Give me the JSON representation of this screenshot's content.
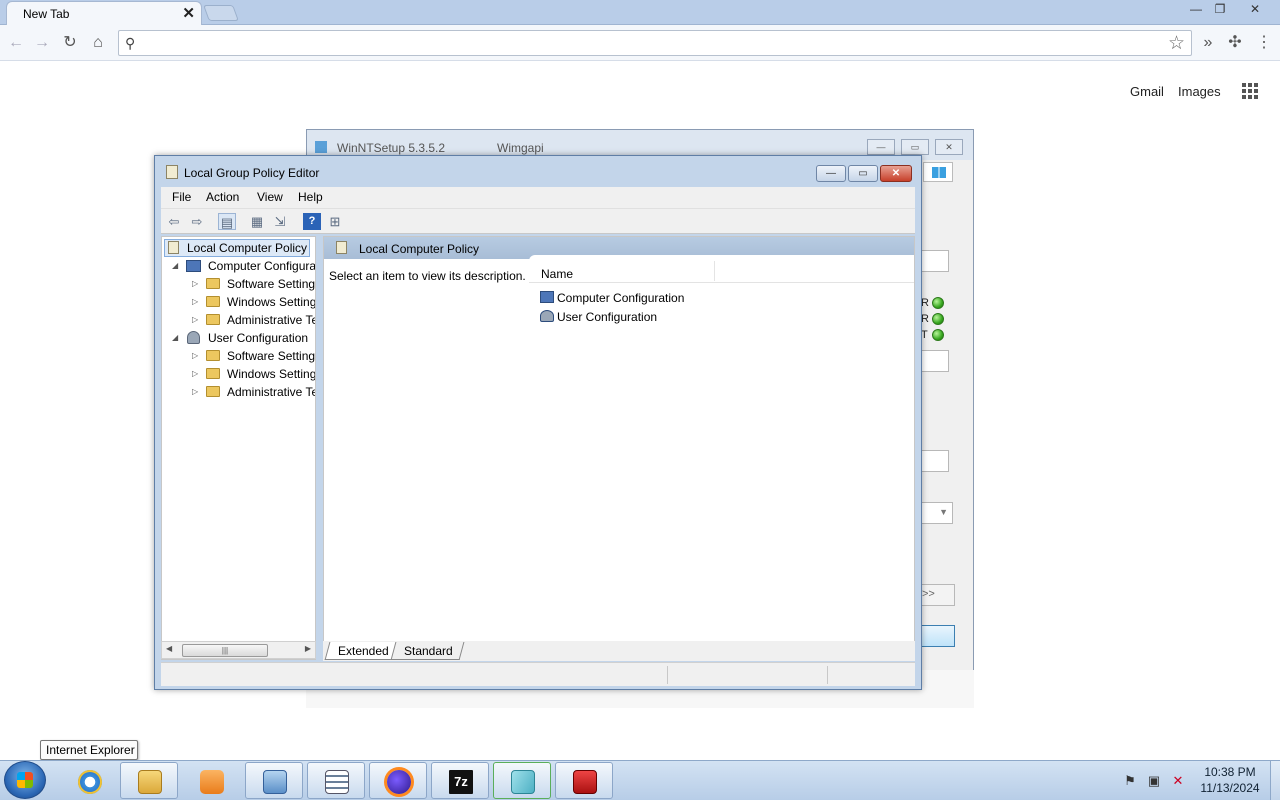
{
  "browser": {
    "tab_title": "New Tab",
    "tab_close": "✕",
    "links": {
      "gmail": "Gmail",
      "images": "Images"
    },
    "omnibox_value": ""
  },
  "winntsetup": {
    "title": "WinNTSetup 5.3.5.2",
    "wimgapi": "Wimgapi",
    "status_letters": [
      "R",
      "R",
      "T"
    ],
    "next_button": ">>"
  },
  "gpedit": {
    "title": "Local Group Policy Editor",
    "menu": [
      "File",
      "Action",
      "View",
      "Help"
    ],
    "tree": {
      "root": "Local Computer Policy",
      "computer": "Computer Configura",
      "computer_children": [
        "Software Settings",
        "Windows Setting",
        "Administrative Te"
      ],
      "user": "User Configuration",
      "user_children": [
        "Software Settings",
        "Windows Setting",
        "Administrative Te"
      ]
    },
    "right_header": "Local Computer Policy",
    "description": "Select an item to view its description.",
    "column_name": "Name",
    "items": [
      "Computer Configuration",
      "User Configuration"
    ],
    "tabs": [
      "Extended",
      "Standard"
    ]
  },
  "tooltip": "Internet Explorer",
  "taskbar": {
    "clock_time": "10:38 PM",
    "clock_date": "11/13/2024",
    "buttons": [
      "internet-explorer",
      "file-explorer",
      "media-player",
      "control-panel",
      "notepad",
      "firefox",
      "7zip",
      "winntsetup",
      "toolbox"
    ]
  }
}
